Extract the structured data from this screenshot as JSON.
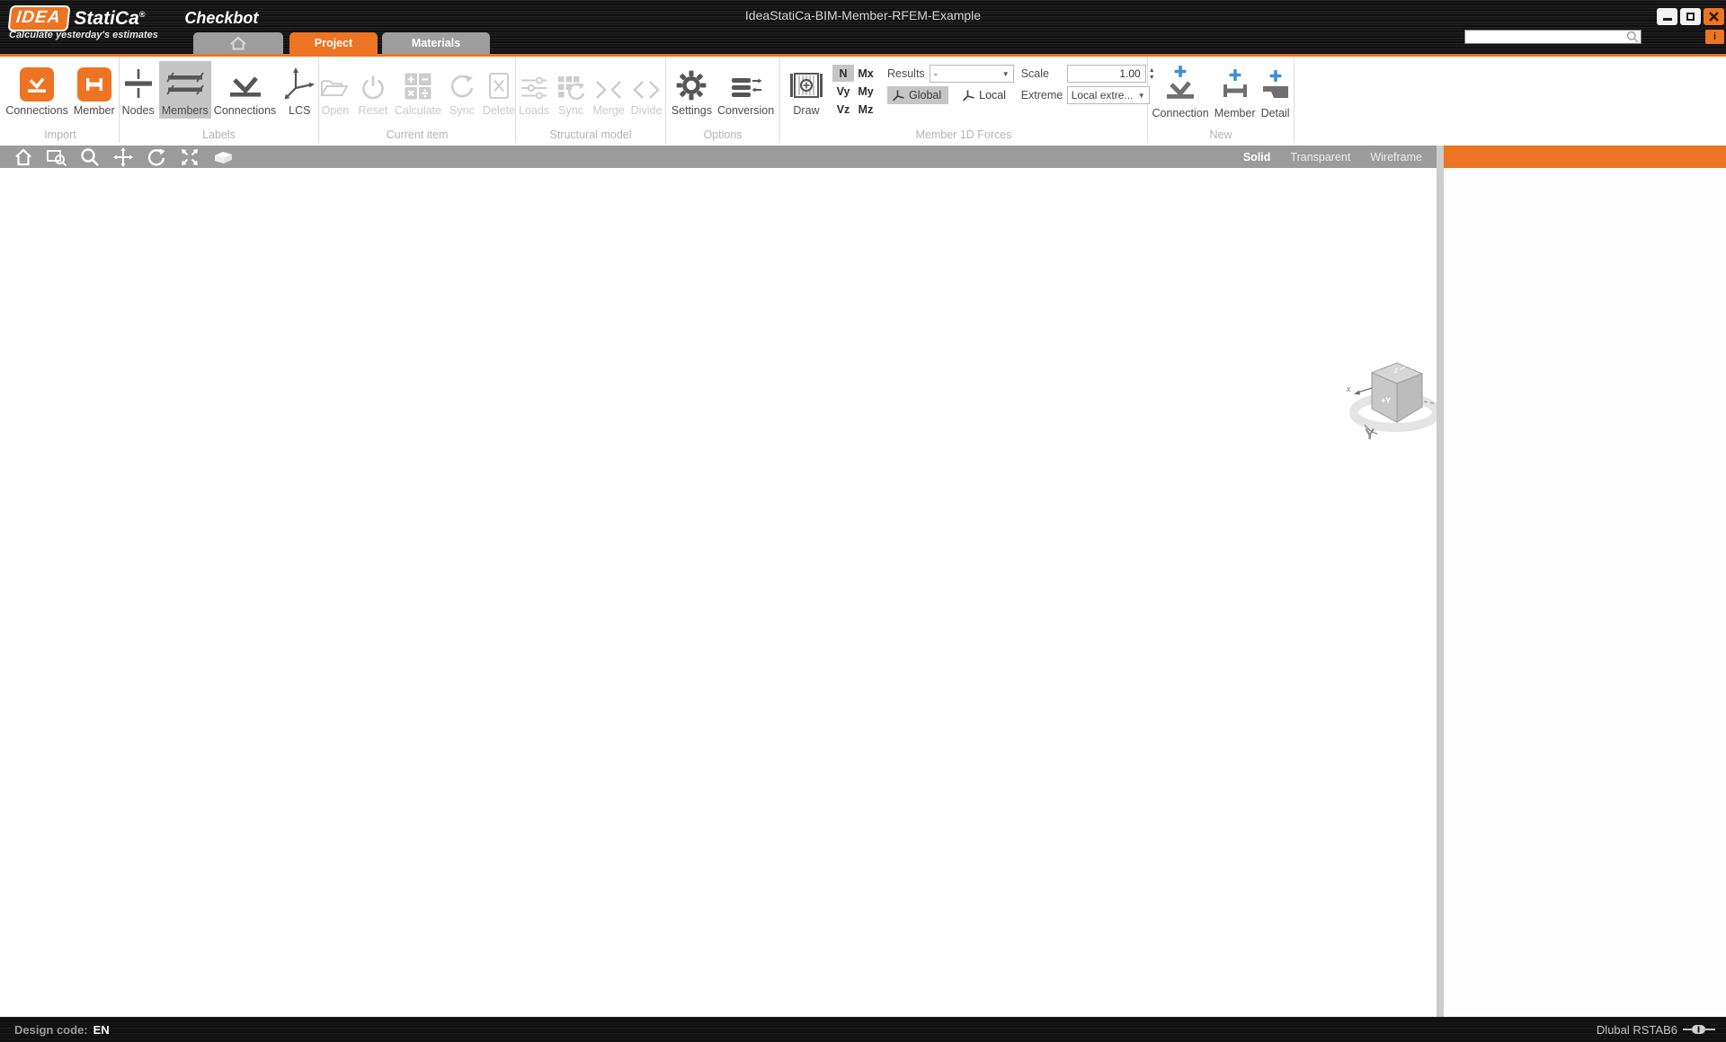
{
  "titlebar": {
    "logo_idea": "IDEA",
    "logo_statica": "StatiCa",
    "logo_reg": "®",
    "app_name": "Checkbot",
    "tagline": "Calculate yesterday's estimates",
    "document_title": "IdeaStatiCa-BIM-Member-RFEM-Example",
    "info_button": "i",
    "search": {
      "placeholder": "",
      "value": ""
    }
  },
  "tabs": {
    "project": "Project",
    "materials": "Materials"
  },
  "ribbon": {
    "groups": {
      "import": {
        "label": "Import",
        "connections": "Connections",
        "member": "Member"
      },
      "labels": {
        "label": "Labels",
        "nodes": "Nodes",
        "members": "Members",
        "connections": "Connections",
        "lcs": "LCS",
        "selected": "Members"
      },
      "current_item": {
        "label": "Current item",
        "open": "Open",
        "reset": "Reset",
        "calculate": "Calculate",
        "sync": "Sync",
        "delete": "Delete",
        "state": "disabled"
      },
      "structural_model": {
        "label": "Structural model",
        "loads": "Loads",
        "sync": "Sync",
        "merge": "Merge",
        "divide": "Divide",
        "state": "disabled"
      },
      "options": {
        "label": "Options",
        "settings": "Settings",
        "conversion": "Conversion"
      },
      "member_1d_forces": {
        "label": "Member 1D Forces",
        "draw": "Draw",
        "toggles": {
          "n": "N",
          "vy": "Vy",
          "vz": "Vz",
          "mx": "Mx",
          "my": "My",
          "mz": "Mz"
        },
        "selected_toggle": "N",
        "results_label": "Results",
        "results_value": "-",
        "global": "Global",
        "local": "Local",
        "coord_selected": "Global",
        "scale_label": "Scale",
        "scale_value": "1.00",
        "extreme_label": "Extreme",
        "extreme_value": "Local extre..."
      },
      "new": {
        "label": "New",
        "connection": "Connection",
        "member": "Member",
        "detail": "Detail"
      }
    }
  },
  "viewbar": {
    "solid": "Solid",
    "transparent": "Transparent",
    "wireframe": "Wireframe",
    "active_mode": "Solid"
  },
  "statusbar": {
    "design_code_label": "Design code:",
    "design_code_value": "EN",
    "plugin_label": "Dlubal RSTAB6"
  }
}
